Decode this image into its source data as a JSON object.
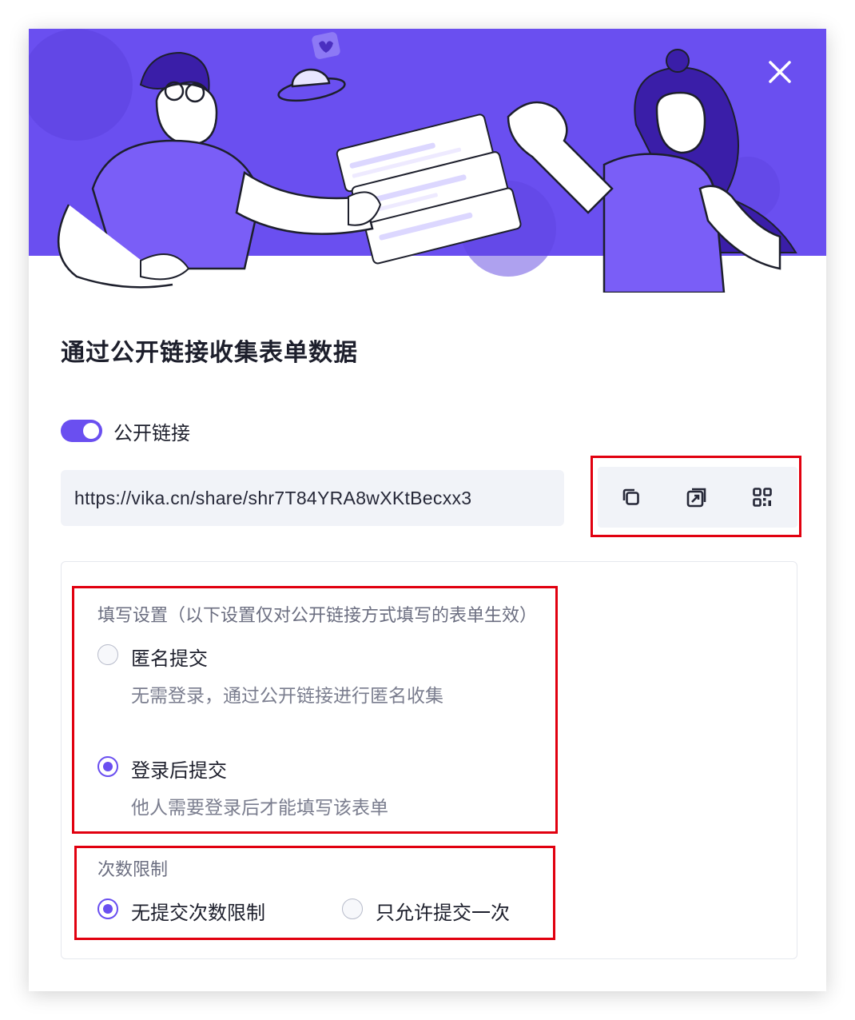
{
  "dialog": {
    "title": "通过公开链接收集表单数据"
  },
  "public_link": {
    "toggle_label": "公开链接",
    "enabled": true,
    "url": "https://vika.cn/share/shr7T84YRA8wXKtBecxx3"
  },
  "actions": {
    "icons": [
      "copy-icon",
      "open-link-icon",
      "qrcode-icon"
    ]
  },
  "fill_settings": {
    "label": "填写设置（以下设置仅对公开链接方式填写的表单生效）",
    "options": [
      {
        "label": "匿名提交",
        "description": "无需登录，通过公开链接进行匿名收集",
        "checked": false
      },
      {
        "label": "登录后提交",
        "description": "他人需要登录后才能填写该表单",
        "checked": true
      }
    ]
  },
  "submit_limit": {
    "label": "次数限制",
    "options": [
      {
        "label": "无提交次数限制",
        "checked": true
      },
      {
        "label": "只允许提交一次",
        "checked": false
      }
    ]
  },
  "colors": {
    "accent": "#6a4ff0",
    "highlight_frame": "#e1000f"
  }
}
